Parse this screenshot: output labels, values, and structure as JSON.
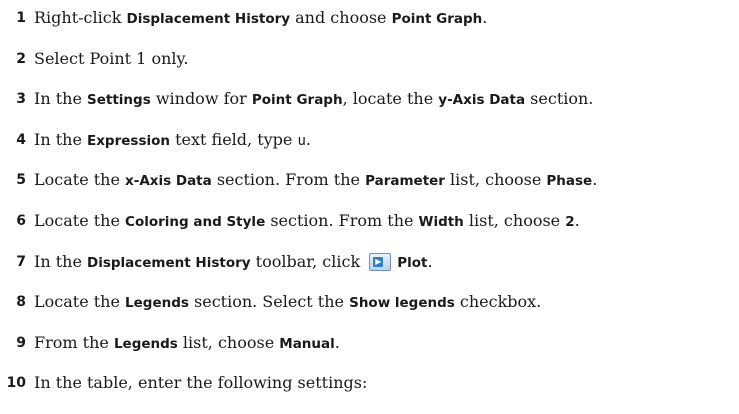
{
  "steps": [
    {
      "num": "1",
      "parts": [
        "Right-click ",
        "Displacement History",
        " and choose ",
        "Point Graph",
        "."
      ]
    },
    {
      "num": "2",
      "parts": [
        "Select Point 1 only."
      ]
    },
    {
      "num": "3",
      "parts": [
        "In the ",
        "Settings",
        " window for ",
        "Point Graph",
        ", locate the ",
        "y-Axis Data",
        " section."
      ]
    },
    {
      "num": "4",
      "parts": [
        "In the ",
        "Expression",
        " text field, type ",
        "u",
        "."
      ]
    },
    {
      "num": "5",
      "parts": [
        "Locate the ",
        "x-Axis Data",
        " section. From the ",
        "Parameter",
        " list, choose ",
        "Phase",
        "."
      ]
    },
    {
      "num": "6",
      "parts": [
        "Locate the ",
        "Coloring and Style",
        " section. From the ",
        "Width",
        " list, choose ",
        "2",
        "."
      ]
    },
    {
      "num": "7",
      "parts": [
        "In the ",
        "Displacement History",
        " toolbar, click ",
        "Plot",
        "."
      ],
      "icon": "plot-icon"
    },
    {
      "num": "8",
      "parts": [
        "Locate the ",
        "Legends",
        " section. Select the ",
        "Show legends",
        " checkbox."
      ]
    },
    {
      "num": "9",
      "parts": [
        "From the ",
        "Legends",
        " list, choose ",
        "Manual",
        "."
      ]
    },
    {
      "num": "10",
      "parts": [
        "In the table, enter the following settings:"
      ]
    }
  ]
}
